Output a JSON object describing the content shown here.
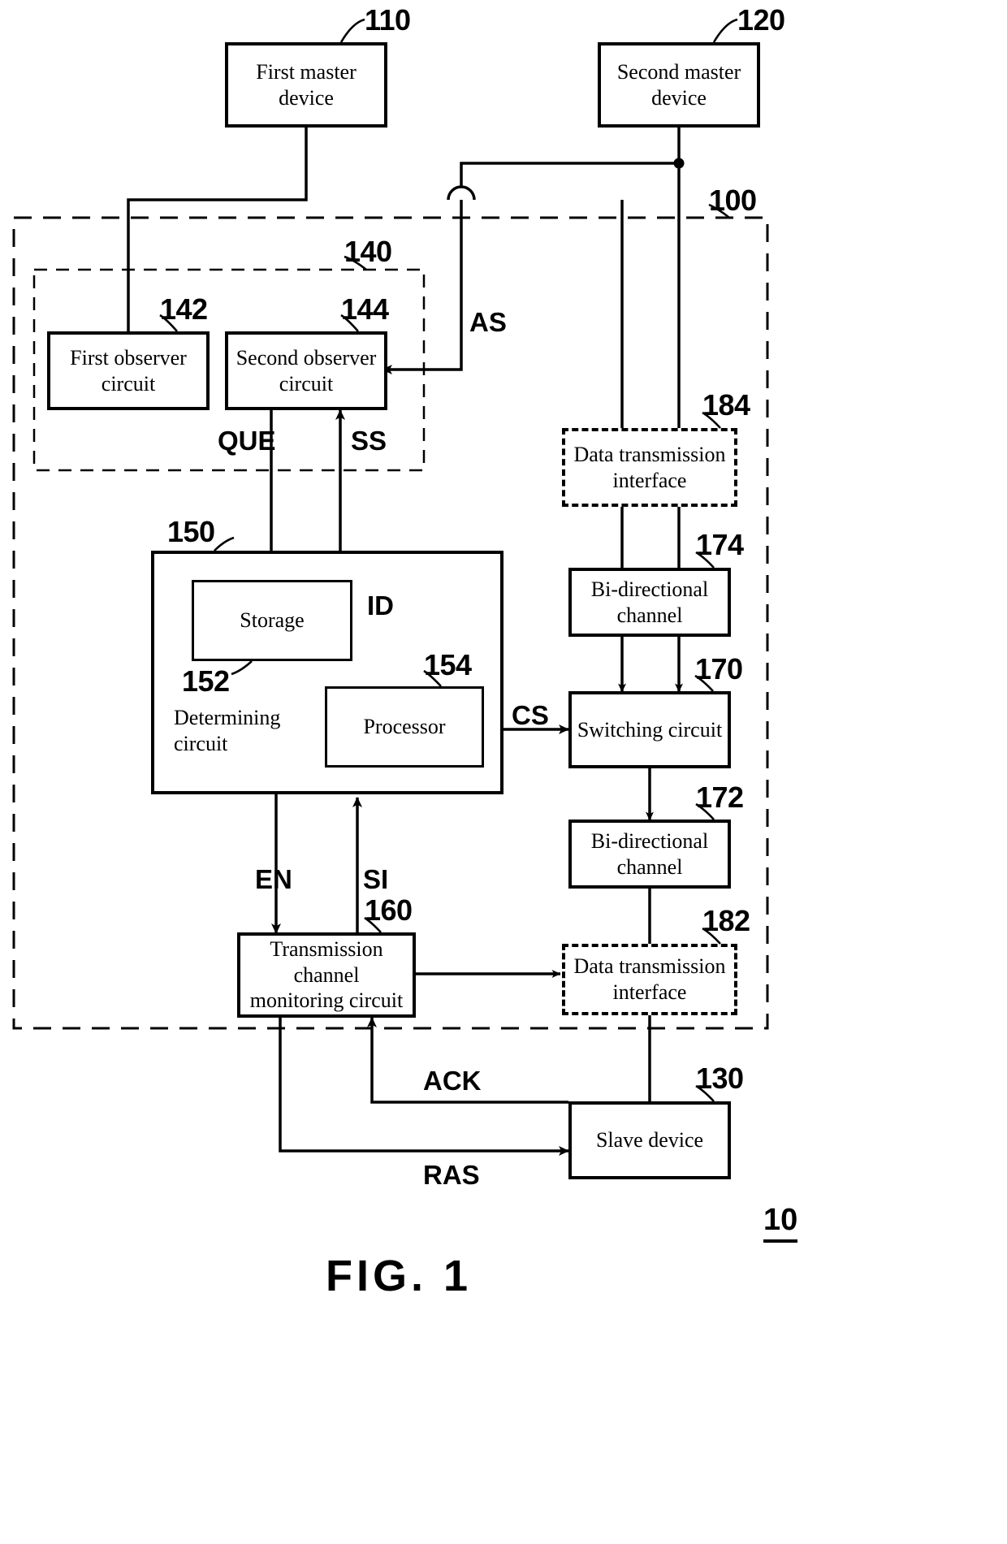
{
  "figure": {
    "caption": "FIG. 1",
    "system_number": "10"
  },
  "blocks": {
    "first_master_device": {
      "label": "First master\ndevice",
      "ref": "110"
    },
    "second_master_device": {
      "label": "Second master\ndevice",
      "ref": "120"
    },
    "first_observer_circuit": {
      "label": "First observer\ncircuit",
      "ref": "142"
    },
    "second_observer_circuit": {
      "label": "Second observer\ncircuit",
      "ref": "144"
    },
    "observer_group": {
      "ref": "140"
    },
    "system_boundary": {
      "ref": "100"
    },
    "determining_circuit": {
      "label": "Determining\ncircuit",
      "ref": "150"
    },
    "storage": {
      "label": "Storage",
      "ref": "152"
    },
    "processor": {
      "label": "Processor",
      "ref": "154"
    },
    "transmission_channel_monitoring_circuit": {
      "label": "Transmission\nchannel\nmonitoring circuit",
      "ref": "160"
    },
    "switching_circuit": {
      "label": "Switching circuit",
      "ref": "170"
    },
    "bidirectional_channel_lower": {
      "label": "Bi-directional\nchannel",
      "ref": "172"
    },
    "bidirectional_channel_upper": {
      "label": "Bi-directional\nchannel",
      "ref": "174"
    },
    "data_transmission_interface_lower": {
      "label": "Data transmission\ninterface",
      "ref": "182"
    },
    "data_transmission_interface_upper": {
      "label": "Data transmission\ninterface",
      "ref": "184"
    },
    "slave_device": {
      "label": "Slave device",
      "ref": "130"
    }
  },
  "signals": {
    "as": "AS",
    "que": "QUE",
    "ss": "SS",
    "id": "ID",
    "cs": "CS",
    "en": "EN",
    "si": "SI",
    "ack": "ACK",
    "ras": "RAS"
  },
  "colors": {
    "line": "#000000",
    "background": "#ffffff"
  }
}
